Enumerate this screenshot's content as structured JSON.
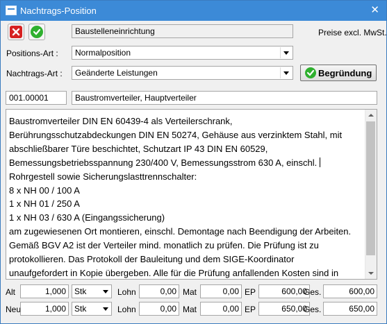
{
  "window": {
    "title": "Nachtrags-Position",
    "close_glyph": "✕"
  },
  "toolbar": {
    "cancel_icon": "cancel-icon",
    "ok_icon": "confirm-check-icon",
    "short_text": "Baustelleneinrichtung",
    "price_note": "Preise excl. MwSt."
  },
  "position_art": {
    "label": "Positions-Art :",
    "value": "Normalposition"
  },
  "nachtrags_art": {
    "label": "Nachtrags-Art :",
    "value": "Geänderte Leistungen"
  },
  "begruendung_button": {
    "label": "Begründung"
  },
  "position": {
    "number": "001.00001",
    "title": "Baustromverteiler, Hauptverteiler"
  },
  "long_text": [
    "Baustromverteiler DIN EN 60439-4 als Verteilerschrank,",
    "Berührungsschutzabdeckungen DIN EN 50274, Gehäuse aus verzinktem Stahl, mit",
    "abschließbarer Türe beschichtet, Schutzart IP 43 DIN EN 60529,",
    "Bemessungsbetriebsspannung 230/400 V, Bemessungsstrom 630 A, einschl.",
    "Rohrgestell sowie Sicherungslasttrennschalter:",
    "8 x NH 00 / 100 A",
    "1 x NH 01 / 250 A",
    "1 x NH 03 / 630 A (Eingangssicherung)",
    "am zugewiesenen Ort montieren, einschl. Demontage nach Beendigung der Arbeiten.",
    "Gemäß BGV A2 ist der Verteiler mind. monatlich zu prüfen. Die Prüfung ist zu",
    "protokollieren. Das Protokoll der Bauleitung und dem SIGE-Koordinator",
    "unaufgefordert in Kopie übergeben. Alle für die Prüfung anfallenden Kosten sind in"
  ],
  "rows": {
    "alt": {
      "label": "Alt",
      "qty": "1,000",
      "unit": "Stk",
      "lohn_label": "Lohn",
      "lohn": "0,00",
      "mat_label": "Mat",
      "mat": "0,00",
      "ep_label": "EP",
      "ep": "600,00",
      "ges_label": "Ges.",
      "ges": "600,00"
    },
    "neu": {
      "label": "Neu",
      "qty": "1,000",
      "unit": "Stk",
      "lohn_label": "Lohn",
      "lohn": "0,00",
      "mat_label": "Mat",
      "mat": "0,00",
      "ep_label": "EP",
      "ep": "650,00",
      "ges_label": "Ges.",
      "ges": "650,00"
    }
  }
}
